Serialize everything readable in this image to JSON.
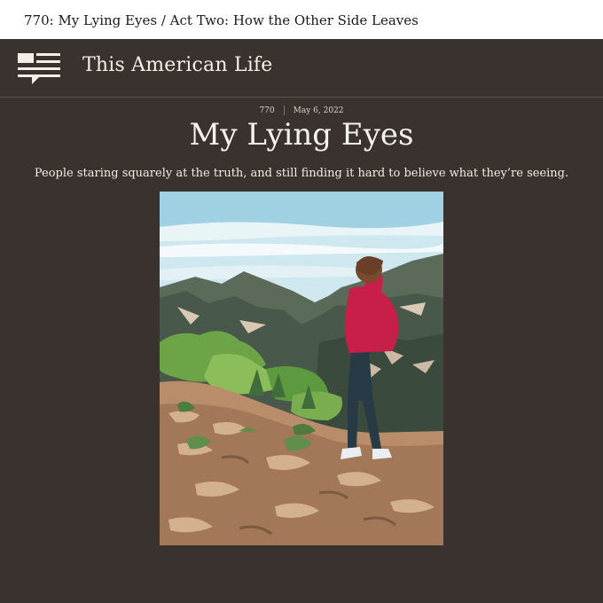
{
  "topbar": {
    "breadcrumb": "770: My Lying Eyes / Act Two: How the Other Side Leaves"
  },
  "header": {
    "logo_icon": "speech-bubble-lines-icon",
    "brand": "This American Life"
  },
  "episode": {
    "number": "770",
    "date": "May 6, 2022",
    "title": "My Lying Eyes",
    "description": "People staring squarely at the truth, and still finding it hard to believe what they’re seeing."
  },
  "colors": {
    "panel_bg": "#3a322e",
    "text_light": "#f3eee8",
    "topbar_bg": "#ffffff"
  }
}
